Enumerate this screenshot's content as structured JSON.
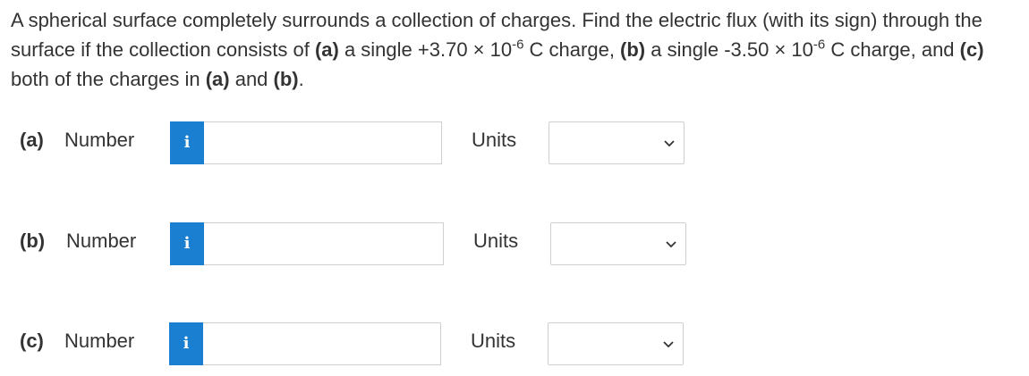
{
  "question": {
    "text_1": "A spherical surface completely surrounds a collection of charges. Find the electric flux (with its sign) through the surface if the collection consists of ",
    "part_a": "(a)",
    "text_2": " a single +3.70 × 10",
    "exp_1": "-6",
    "text_3": " C charge, ",
    "part_b": "(b)",
    "text_4": " a single -3.50 × 10",
    "exp_2": "-6",
    "text_5": " C charge, and ",
    "part_c": "(c)",
    "text_6": " both of the charges in ",
    "part_a_ref": "(a)",
    "text_7": " and ",
    "part_b_ref": "(b)",
    "text_8": "."
  },
  "answers": [
    {
      "part": "(a)",
      "number_label": "Number",
      "info_icon": "i",
      "number_value": "",
      "units_label": "Units",
      "units_selected": ""
    },
    {
      "part": "(b)",
      "number_label": "Number",
      "info_icon": "i",
      "number_value": "",
      "units_label": "Units",
      "units_selected": ""
    },
    {
      "part": "(c)",
      "number_label": "Number",
      "info_icon": "i",
      "number_value": "",
      "units_label": "Units",
      "units_selected": ""
    }
  ],
  "colors": {
    "info_button": "#1a7fd0",
    "text": "#333333",
    "border": "#cfcfcf"
  },
  "icons": {
    "info": "info-icon",
    "dropdown": "chevron-down-icon"
  }
}
